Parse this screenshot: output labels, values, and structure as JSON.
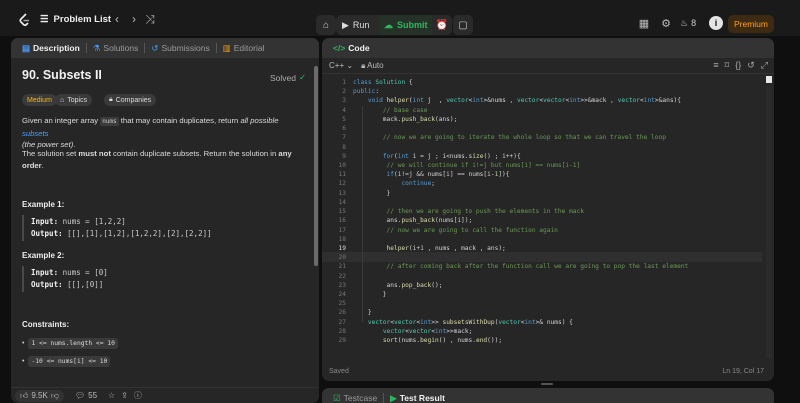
{
  "topbar": {
    "problem_list_label": "Problem List",
    "run_label": "Run",
    "submit_label": "Submit",
    "streak_count": "8",
    "avatar_letter": "i",
    "premium_label": "Premium"
  },
  "left": {
    "tabs": [
      {
        "label": "Description"
      },
      {
        "label": "Solutions"
      },
      {
        "label": "Submissions"
      },
      {
        "label": "Editorial"
      }
    ],
    "title": "90. Subsets II",
    "status": "Solved",
    "difficulty": "Medium",
    "topics_label": "Topics",
    "companies_label": "Companies",
    "desc1_a": "Given an integer array ",
    "desc1_code": "nums",
    "desc1_b": " that may contain duplicates, return ",
    "desc1_c": "all possible ",
    "desc1_link": "subsets",
    "desc1_d": "(the power set)",
    "desc1_e": ".",
    "desc2_a": "The solution set ",
    "desc2_b": "must not",
    "desc2_c": " contain duplicate subsets. Return the solution in ",
    "desc2_d": "any order",
    "desc2_e": ".",
    "example1_title": "Example 1:",
    "example1_input_label": "Input:",
    "example1_input": "nums = [1,2,2]",
    "example1_output_label": "Output:",
    "example1_output": "[[],[1],[1,2],[1,2,2],[2],[2,2]]",
    "example2_title": "Example 2:",
    "example2_input_label": "Input:",
    "example2_input": "nums = [0]",
    "example2_output_label": "Output:",
    "example2_output": "[[],[0]]",
    "constraints_title": "Constraints:",
    "constraint1": "1 <= nums.length <= 10",
    "constraint2": "-10 <= nums[i] <= 10",
    "likes": "9.5K",
    "comments": "55"
  },
  "code_panel": {
    "tab_label": "Code",
    "language": "C++",
    "auto_label": "Auto",
    "status": "Saved",
    "cursor": "Ln 19, Col 17"
  },
  "bottom_panel": {
    "testcase_label": "Testcase",
    "result_label": "Test Result"
  },
  "code_lines": [
    "class Solution {",
    "public:",
    "    void helper(int j  , vector<int>&nums , vector<vector<int>>&mack , vector<int>&ans){",
    "        // base case",
    "        mack.push_back(ans);",
    "",
    "        // now we are going to iterate the whole loop so that we can travel the loop",
    "",
    "        for(int i = j ; i<nums.size() ; i++){",
    "         // we will continue if i!=j but nums[i] == nums[i-1]",
    "         if(i!=j && nums[i] == nums[i-1]){",
    "             continue;",
    "         }",
    "",
    "         // then we are going to push the elements in the mack",
    "         ans.push_back(nums[i]);",
    "         // now we are going to call the function again",
    "",
    "         helper(i+1 , nums , mack , ans);",
    "",
    "         // after coming back after the function call we are going to pop the last element",
    "",
    "         ans.pop_back();",
    "        }",
    "",
    "    }",
    "    vector<vector<int>> subsetsWithDup(vector<int>& nums) {",
    "        vector<vector<int>>mack;",
    "        sort(nums.begin() , nums.end());"
  ],
  "line_numbers": [
    "1",
    "2",
    "3",
    "4",
    "5",
    "6",
    "7",
    "8",
    "9",
    "10",
    "11",
    "12",
    "13",
    "14",
    "15",
    "16",
    "17",
    "18",
    "19",
    "20",
    "21",
    "22",
    "23",
    "24",
    "25",
    "26",
    "27",
    "28",
    "29"
  ]
}
